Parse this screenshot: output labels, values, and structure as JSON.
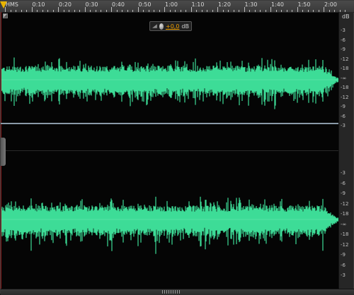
{
  "time_ruler": {
    "labels": [
      "HMS",
      "0:10",
      "0:20",
      "0:30",
      "0:40",
      "0:50",
      "1:00",
      "1:10",
      "1:20",
      "1:30",
      "1:40",
      "1:50",
      "2:00"
    ]
  },
  "db_ruler": {
    "unit": "dB",
    "top_channel_labels": [
      "-3",
      "-6",
      "-9",
      "-12",
      "-18",
      "-∞",
      "-18",
      "-12",
      "-9",
      "-6",
      "-3"
    ],
    "bottom_channel_labels": [
      "-3",
      "-6",
      "-9",
      "-12",
      "-18",
      "-∞",
      "-18",
      "-12",
      "-9",
      "-6",
      "-3"
    ]
  },
  "hud": {
    "amplitude_value": "+0,0",
    "amplitude_unit": "dB"
  },
  "colors": {
    "waveform": "#3ddc97",
    "background": "#050505",
    "playhead_marker": "#e8b400",
    "hud_value": "#f0a000"
  },
  "icons": {
    "playhead": "playhead-marker-icon",
    "corner": "track-corner-icon",
    "volume_ramp": "volume-ramp-icon",
    "volume_knob": "volume-knob-icon",
    "resize": "resize-handle-icon"
  }
}
